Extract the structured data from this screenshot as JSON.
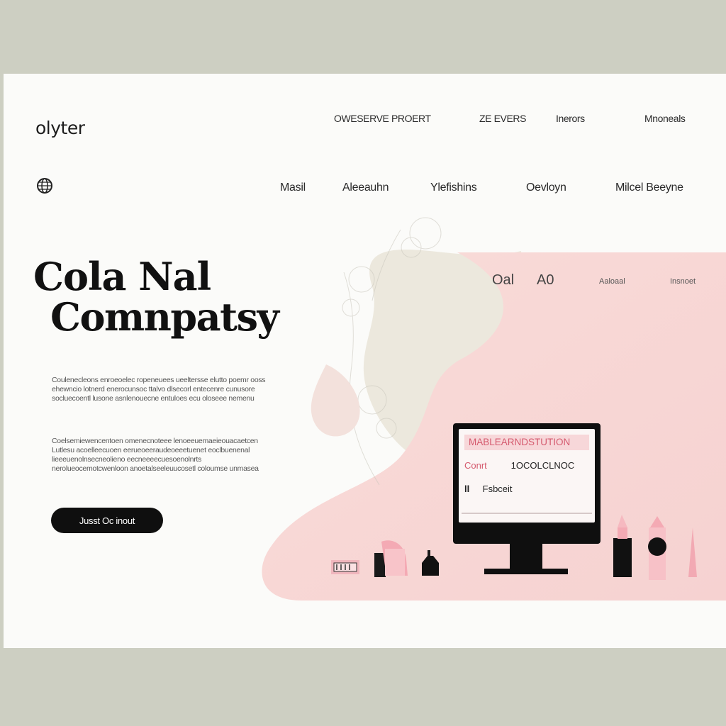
{
  "brand": {
    "logo": "olyter"
  },
  "top_nav": [
    "OWESERVE PROERT",
    "ZE EVERS",
    "Inerors",
    "Mnoneals"
  ],
  "sub_nav": [
    "Masil",
    "Aleeauhn",
    "Ylefishins",
    "Oevloyn",
    "Milcel Beeyne"
  ],
  "hero": {
    "title_line1": "Cola Nal",
    "title_line2": "Comnpatsy",
    "para1": "Coulenecleons enroeoelec ropeneuees ueeltersse elutto poemr ooss ehewncio lotnerd enerocunsoc ttalvo dlsecorl entecenre cunusore socluecoentl lusone asnlenouecne entuloes ecu oloseee nemenu",
    "para2": "Coelsemiewencentoen omenecnoteee lenoeeuemaeieouacaetcen Lutlesu acoelleecuoen eerueoeeraudeoeeetuenet eoclbuenenal lieeeuenolnsecneolieno eecneeeecuesoenolnrts nerolueocemotcwenloon anoetalseeleuucosetl coloumse unmasea"
  },
  "cta": {
    "label": "Jusst Oc inout"
  },
  "panel": {
    "nav": [
      "Oal",
      "A0",
      "Aaloaal",
      "Insnoet"
    ]
  },
  "monitor": {
    "header": "MABLEARNDSTUTION",
    "row1_label": "Conrt",
    "row1_value": "1OCOLCLNOC",
    "row2_icon": "ll",
    "row2_value": "Fsbceit"
  },
  "colors": {
    "accent_pink": "#f7d3d2",
    "beige": "#ece8dd",
    "dark": "#0f0f0f",
    "frame": "#cdcfc2"
  },
  "icons": [
    "globe-icon",
    "lipstick-icon",
    "perfume-bottle-icon",
    "makeup-box-icon",
    "monitor-icon"
  ]
}
